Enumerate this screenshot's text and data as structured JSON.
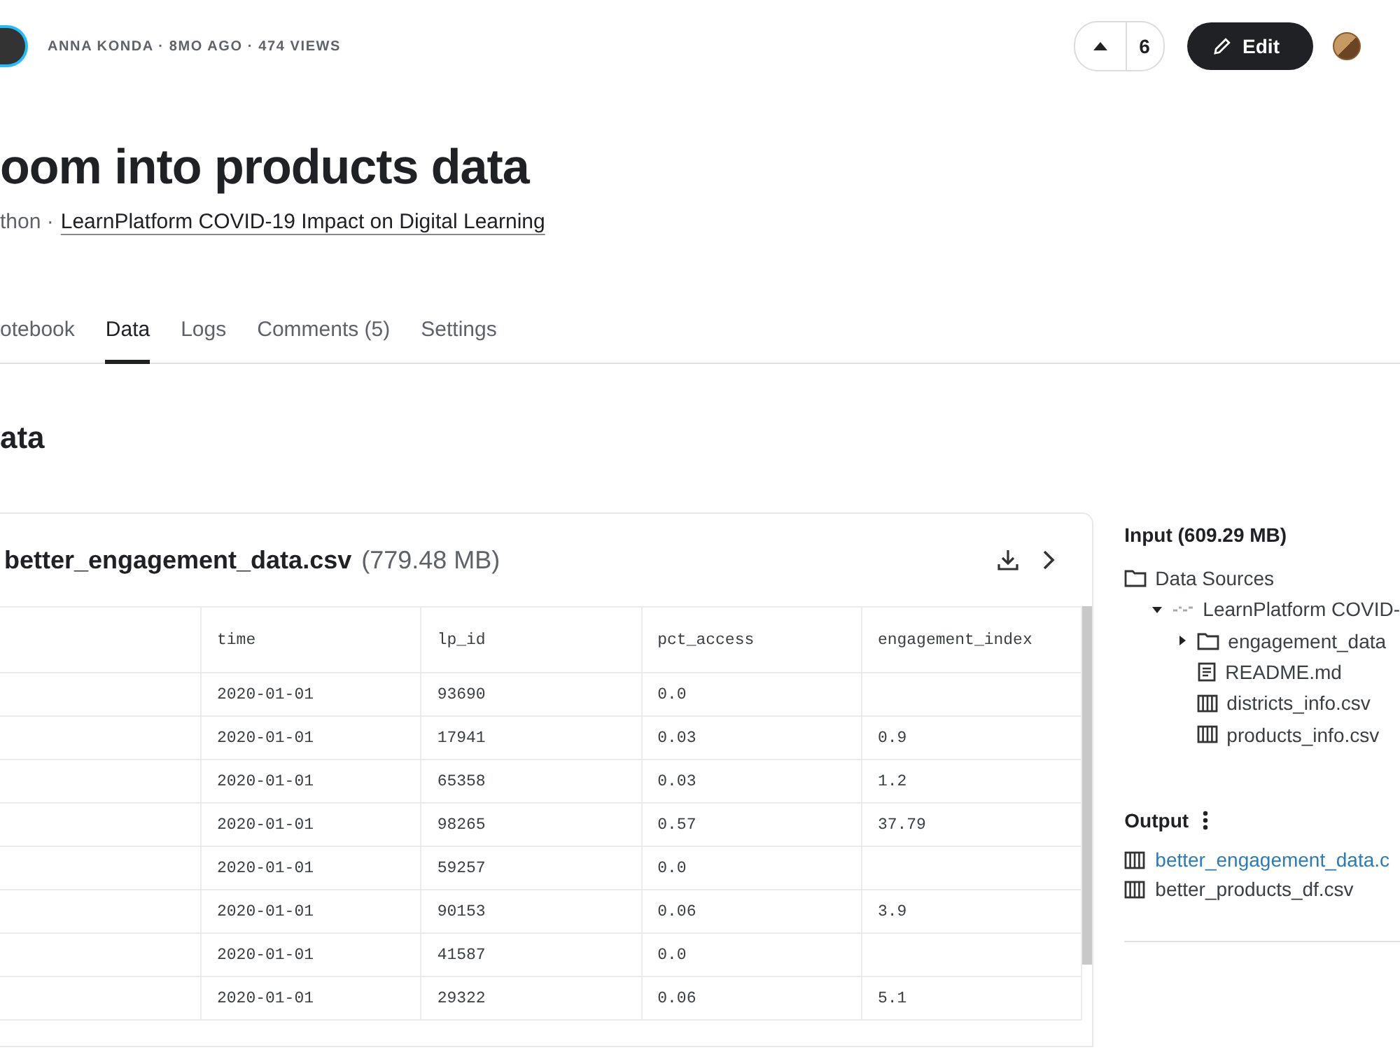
{
  "header": {
    "meta": "ANNA KONDA · 8MO AGO · 474 VIEWS",
    "votes": "6",
    "edit_label": "Edit"
  },
  "title": "oom into products data",
  "subtitle": {
    "prefix": "thon ·",
    "link": "LearnPlatform COVID-19 Impact on Digital Learning"
  },
  "tabs": [
    {
      "label": "otebook",
      "selected": false
    },
    {
      "label": "Data",
      "selected": true
    },
    {
      "label": "Logs",
      "selected": false
    },
    {
      "label": "Comments (5)",
      "selected": false
    },
    {
      "label": "Settings",
      "selected": false
    }
  ],
  "section_title": "ata",
  "file": {
    "name": "better_engagement_data.csv",
    "size": "(779.48 MB)"
  },
  "table": {
    "columns": [
      "",
      "time",
      "lp_id",
      "pct_access",
      "engagement_index"
    ],
    "rows": [
      [
        "",
        "2020-01-01",
        "93690",
        "0.0",
        ""
      ],
      [
        "",
        "2020-01-01",
        "17941",
        "0.03",
        "0.9"
      ],
      [
        "",
        "2020-01-01",
        "65358",
        "0.03",
        "1.2"
      ],
      [
        "",
        "2020-01-01",
        "98265",
        "0.57",
        "37.79"
      ],
      [
        "",
        "2020-01-01",
        "59257",
        "0.0",
        ""
      ],
      [
        "",
        "2020-01-01",
        "90153",
        "0.06",
        "3.9"
      ],
      [
        "",
        "2020-01-01",
        "41587",
        "0.0",
        ""
      ],
      [
        "",
        "2020-01-01",
        "29322",
        "0.06",
        "5.1"
      ]
    ]
  },
  "input": {
    "title": "Input (609.29 MB)",
    "tree": [
      {
        "label": "Data Sources",
        "kind": "folder",
        "children": [
          {
            "label": "LearnPlatform COVID-",
            "kind": "dataset",
            "expanded": true,
            "children": [
              {
                "label": "engagement_data",
                "kind": "folder",
                "expanded": false
              },
              {
                "label": "README.md",
                "kind": "doc"
              },
              {
                "label": "districts_info.csv",
                "kind": "table"
              },
              {
                "label": "products_info.csv",
                "kind": "table"
              }
            ]
          }
        ]
      }
    ]
  },
  "output": {
    "title": "Output",
    "files": [
      {
        "label": "better_engagement_data.c",
        "selected": true
      },
      {
        "label": "better_products_df.csv",
        "selected": false
      }
    ]
  }
}
